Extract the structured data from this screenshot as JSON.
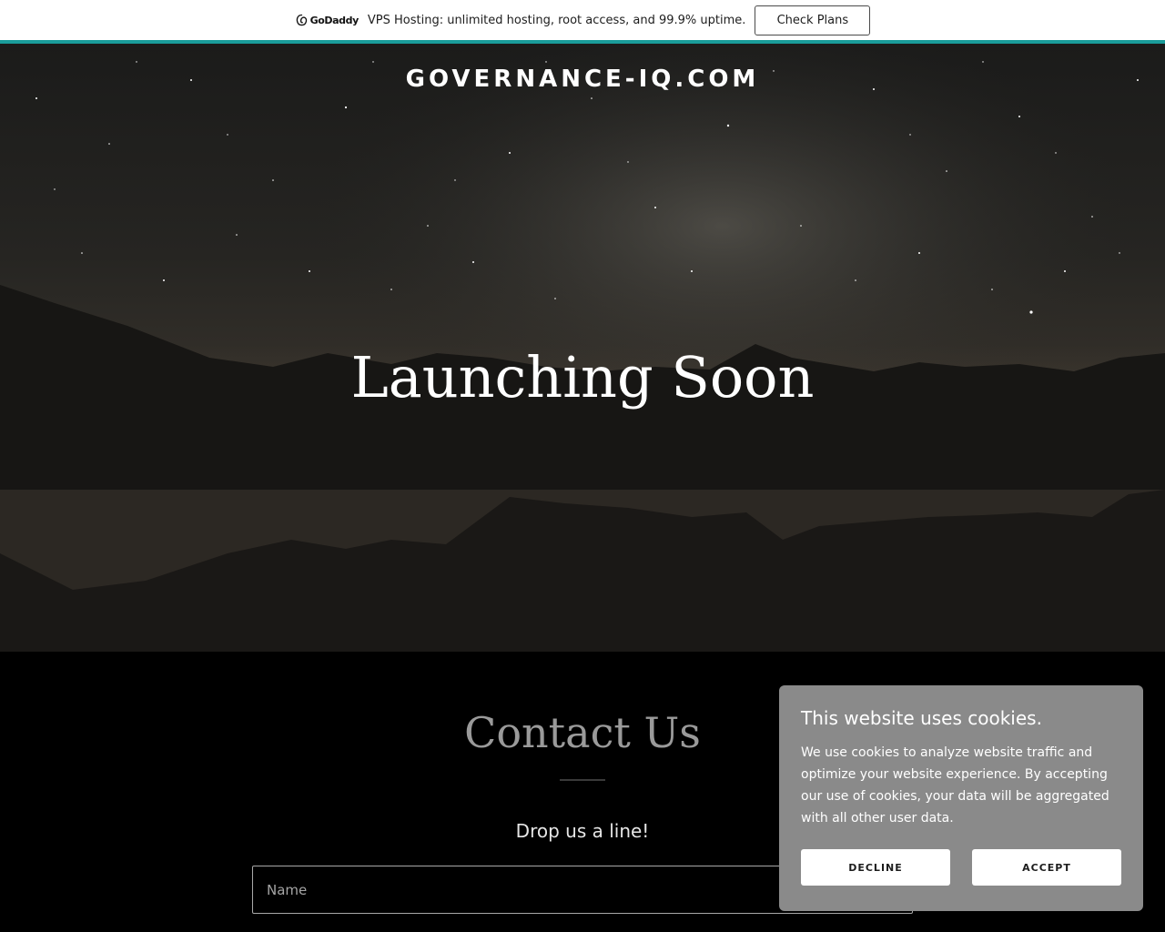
{
  "promo": {
    "brand": "GoDaddy",
    "text": "VPS Hosting: unlimited hosting, root access, and 99.9% uptime.",
    "button_label": "Check Plans",
    "accent_color": "#1a9c9a"
  },
  "hero": {
    "site_name": "GOVERNANCE-IQ.COM",
    "title": "Launching Soon"
  },
  "contact": {
    "title": "Contact Us",
    "subtitle": "Drop us a line!",
    "name_placeholder": "Name"
  },
  "cookie_banner": {
    "title": "This website uses cookies.",
    "body": "We use cookies to analyze website traffic and optimize your website experience. By accepting our use of cookies, your data will be aggregated with all other user data.",
    "decline_label": "DECLINE",
    "accept_label": "ACCEPT"
  }
}
